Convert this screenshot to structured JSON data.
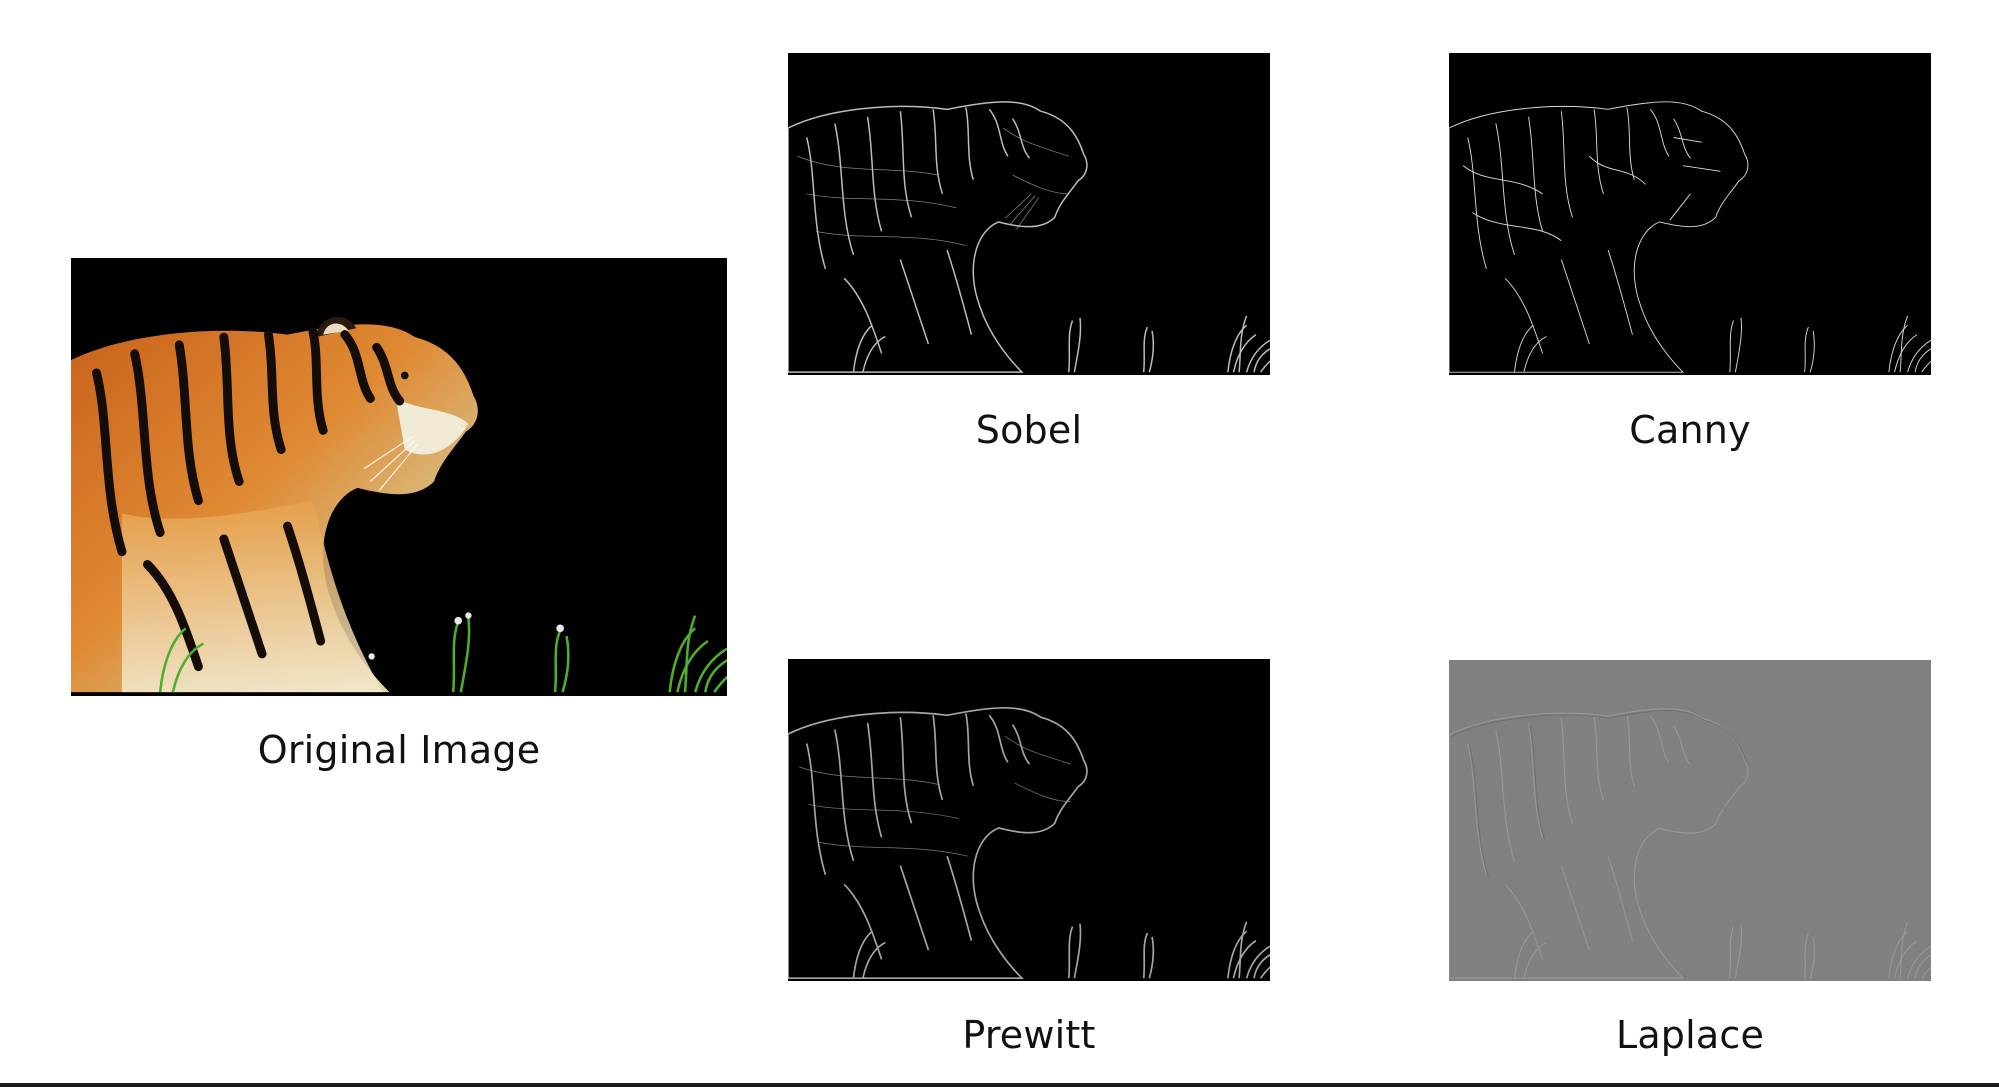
{
  "panels": {
    "original": {
      "caption": "Original Image"
    },
    "sobel": {
      "caption": "Sobel"
    },
    "canny": {
      "caption": "Canny"
    },
    "prewitt": {
      "caption": "Prewitt"
    },
    "laplace": {
      "caption": "Laplace"
    }
  },
  "colors": {
    "page_background": "#ffffff",
    "image_background": "#000000",
    "laplace_background": "#808080",
    "tiger_orange": "#d9731f",
    "tiger_cream": "#e8dcb0",
    "grass_green": "#4fae2e",
    "caption_text": "#111111"
  }
}
